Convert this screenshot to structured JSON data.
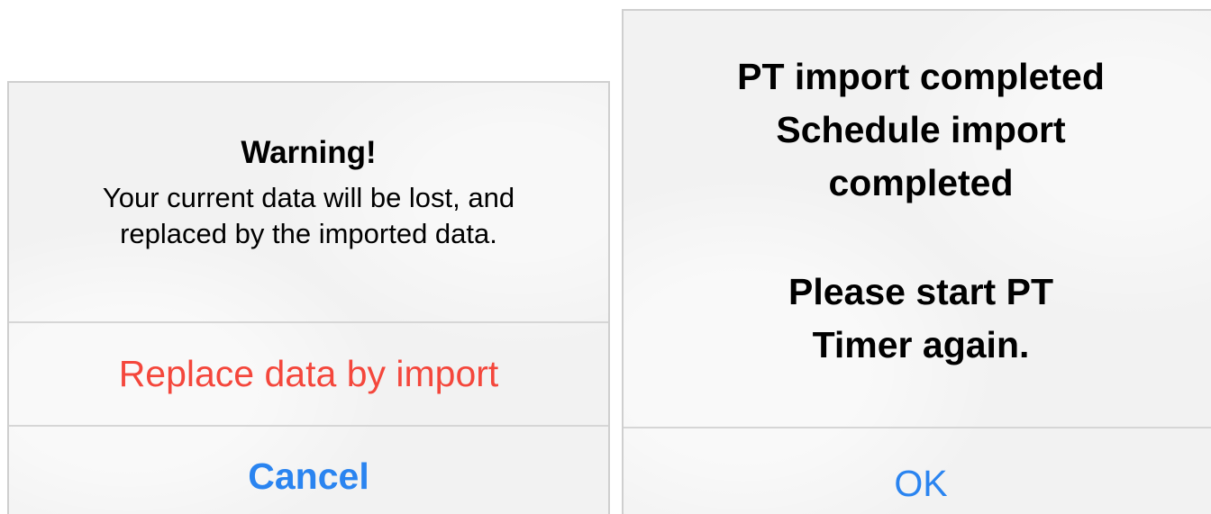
{
  "warning_dialog": {
    "title": "Warning!",
    "message_line1": "Your current data will be lost, and",
    "message_line2": "replaced by the imported data.",
    "replace_label": "Replace data by import",
    "cancel_label": "Cancel"
  },
  "completion_dialog": {
    "line1": "PT import completed",
    "line2": "Schedule import",
    "line3": "completed",
    "line4": "Please start PT",
    "line5": "Timer again.",
    "ok_label": "OK"
  },
  "colors": {
    "destructive": "#f4473c",
    "action": "#2a84f0",
    "dialog_background": "#f2f2f2"
  }
}
